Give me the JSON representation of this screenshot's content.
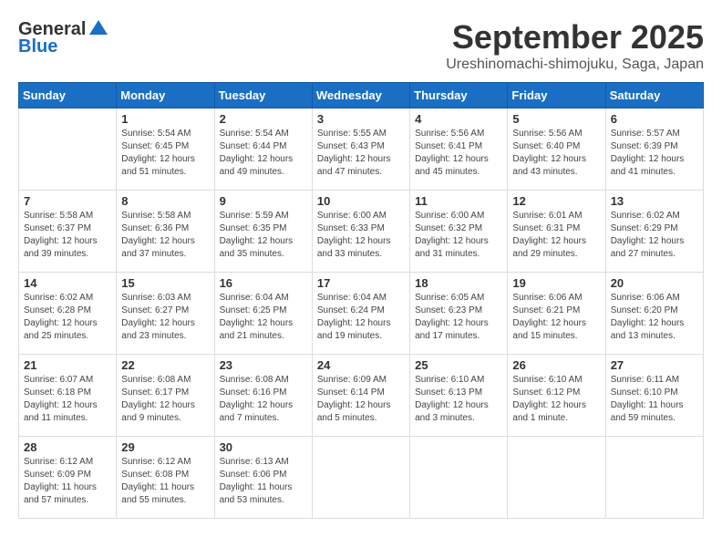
{
  "header": {
    "logo_general": "General",
    "logo_blue": "Blue",
    "month_title": "September 2025",
    "location": "Ureshinomachi-shimojuku, Saga, Japan"
  },
  "days_of_week": [
    "Sunday",
    "Monday",
    "Tuesday",
    "Wednesday",
    "Thursday",
    "Friday",
    "Saturday"
  ],
  "weeks": [
    [
      {
        "day": "",
        "info": ""
      },
      {
        "day": "1",
        "info": "Sunrise: 5:54 AM\nSunset: 6:45 PM\nDaylight: 12 hours\nand 51 minutes."
      },
      {
        "day": "2",
        "info": "Sunrise: 5:54 AM\nSunset: 6:44 PM\nDaylight: 12 hours\nand 49 minutes."
      },
      {
        "day": "3",
        "info": "Sunrise: 5:55 AM\nSunset: 6:43 PM\nDaylight: 12 hours\nand 47 minutes."
      },
      {
        "day": "4",
        "info": "Sunrise: 5:56 AM\nSunset: 6:41 PM\nDaylight: 12 hours\nand 45 minutes."
      },
      {
        "day": "5",
        "info": "Sunrise: 5:56 AM\nSunset: 6:40 PM\nDaylight: 12 hours\nand 43 minutes."
      },
      {
        "day": "6",
        "info": "Sunrise: 5:57 AM\nSunset: 6:39 PM\nDaylight: 12 hours\nand 41 minutes."
      }
    ],
    [
      {
        "day": "7",
        "info": "Sunrise: 5:58 AM\nSunset: 6:37 PM\nDaylight: 12 hours\nand 39 minutes."
      },
      {
        "day": "8",
        "info": "Sunrise: 5:58 AM\nSunset: 6:36 PM\nDaylight: 12 hours\nand 37 minutes."
      },
      {
        "day": "9",
        "info": "Sunrise: 5:59 AM\nSunset: 6:35 PM\nDaylight: 12 hours\nand 35 minutes."
      },
      {
        "day": "10",
        "info": "Sunrise: 6:00 AM\nSunset: 6:33 PM\nDaylight: 12 hours\nand 33 minutes."
      },
      {
        "day": "11",
        "info": "Sunrise: 6:00 AM\nSunset: 6:32 PM\nDaylight: 12 hours\nand 31 minutes."
      },
      {
        "day": "12",
        "info": "Sunrise: 6:01 AM\nSunset: 6:31 PM\nDaylight: 12 hours\nand 29 minutes."
      },
      {
        "day": "13",
        "info": "Sunrise: 6:02 AM\nSunset: 6:29 PM\nDaylight: 12 hours\nand 27 minutes."
      }
    ],
    [
      {
        "day": "14",
        "info": "Sunrise: 6:02 AM\nSunset: 6:28 PM\nDaylight: 12 hours\nand 25 minutes."
      },
      {
        "day": "15",
        "info": "Sunrise: 6:03 AM\nSunset: 6:27 PM\nDaylight: 12 hours\nand 23 minutes."
      },
      {
        "day": "16",
        "info": "Sunrise: 6:04 AM\nSunset: 6:25 PM\nDaylight: 12 hours\nand 21 minutes."
      },
      {
        "day": "17",
        "info": "Sunrise: 6:04 AM\nSunset: 6:24 PM\nDaylight: 12 hours\nand 19 minutes."
      },
      {
        "day": "18",
        "info": "Sunrise: 6:05 AM\nSunset: 6:23 PM\nDaylight: 12 hours\nand 17 minutes."
      },
      {
        "day": "19",
        "info": "Sunrise: 6:06 AM\nSunset: 6:21 PM\nDaylight: 12 hours\nand 15 minutes."
      },
      {
        "day": "20",
        "info": "Sunrise: 6:06 AM\nSunset: 6:20 PM\nDaylight: 12 hours\nand 13 minutes."
      }
    ],
    [
      {
        "day": "21",
        "info": "Sunrise: 6:07 AM\nSunset: 6:18 PM\nDaylight: 12 hours\nand 11 minutes."
      },
      {
        "day": "22",
        "info": "Sunrise: 6:08 AM\nSunset: 6:17 PM\nDaylight: 12 hours\nand 9 minutes."
      },
      {
        "day": "23",
        "info": "Sunrise: 6:08 AM\nSunset: 6:16 PM\nDaylight: 12 hours\nand 7 minutes."
      },
      {
        "day": "24",
        "info": "Sunrise: 6:09 AM\nSunset: 6:14 PM\nDaylight: 12 hours\nand 5 minutes."
      },
      {
        "day": "25",
        "info": "Sunrise: 6:10 AM\nSunset: 6:13 PM\nDaylight: 12 hours\nand 3 minutes."
      },
      {
        "day": "26",
        "info": "Sunrise: 6:10 AM\nSunset: 6:12 PM\nDaylight: 12 hours\nand 1 minute."
      },
      {
        "day": "27",
        "info": "Sunrise: 6:11 AM\nSunset: 6:10 PM\nDaylight: 11 hours\nand 59 minutes."
      }
    ],
    [
      {
        "day": "28",
        "info": "Sunrise: 6:12 AM\nSunset: 6:09 PM\nDaylight: 11 hours\nand 57 minutes."
      },
      {
        "day": "29",
        "info": "Sunrise: 6:12 AM\nSunset: 6:08 PM\nDaylight: 11 hours\nand 55 minutes."
      },
      {
        "day": "30",
        "info": "Sunrise: 6:13 AM\nSunset: 6:06 PM\nDaylight: 11 hours\nand 53 minutes."
      },
      {
        "day": "",
        "info": ""
      },
      {
        "day": "",
        "info": ""
      },
      {
        "day": "",
        "info": ""
      },
      {
        "day": "",
        "info": ""
      }
    ]
  ]
}
